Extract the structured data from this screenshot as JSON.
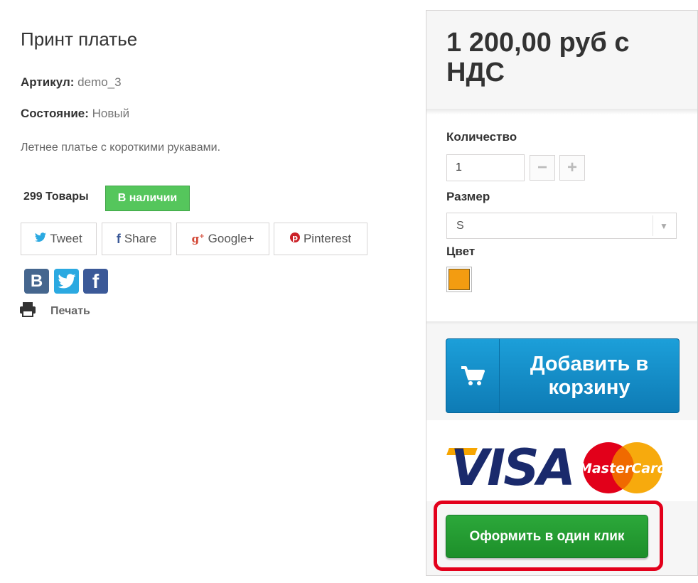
{
  "product": {
    "title": "Принт платье",
    "sku_label": "Артикул:",
    "sku_value": "demo_3",
    "condition_label": "Состояние:",
    "condition_value": "Новый",
    "description": "Летнее платье с короткими рукавами.",
    "stock_count": "299 Товары",
    "stock_status": "В наличии"
  },
  "share": {
    "tweet": "Tweet",
    "share": "Share",
    "google": "Google+",
    "pinterest": "Pinterest",
    "vk_letter": "B",
    "facebook_letter": "f",
    "print_label": "Печать"
  },
  "buy_box": {
    "price": "1 200,00 руб с НДС",
    "quantity_label": "Количество",
    "quantity_value": "1",
    "minus": "−",
    "plus": "+",
    "size_label": "Размер",
    "size_value": "S",
    "color_label": "Цвет",
    "color_value": "#f39c11",
    "add_to_cart": "Добавить в корзину",
    "card_visa": "VISA",
    "card_mastercard": "MasterCard",
    "one_click": "Оформить в один клик"
  },
  "colors": {
    "stock_green": "#55c65c",
    "cart_blue": "#1590cc",
    "oneclick_green": "#24a032",
    "highlight_red": "#e3001b"
  }
}
